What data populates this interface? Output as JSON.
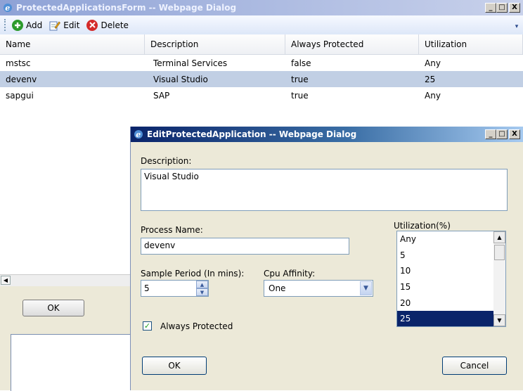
{
  "main_window": {
    "title": "ProtectedApplicationsForm -- Webpage Dialog",
    "caption_buttons": {
      "minimize": "_",
      "maximize": "□",
      "close": "X"
    },
    "toolbar": {
      "add_label": "Add",
      "edit_label": "Edit",
      "delete_label": "Delete",
      "icons": {
        "add": "add-icon",
        "edit": "edit-icon",
        "delete": "delete-icon"
      }
    },
    "grid": {
      "columns": [
        "Name",
        "Description",
        "Always Protected",
        "Utilization"
      ],
      "rows": [
        {
          "name": "mstsc",
          "description": "Terminal Services",
          "always_protected": "false",
          "utilization": "Any",
          "selected": false
        },
        {
          "name": "devenv",
          "description": "Visual Studio",
          "always_protected": "true",
          "utilization": "25",
          "selected": true
        },
        {
          "name": "sapgui",
          "description": "SAP",
          "always_protected": "true",
          "utilization": "Any",
          "selected": false
        }
      ]
    },
    "ok_label": "OK"
  },
  "edit_dialog": {
    "title": "EditProtectedApplication -- Webpage Dialog",
    "caption_buttons": {
      "minimize": "_",
      "maximize": "□",
      "close": "X"
    },
    "description_label": "Description:",
    "description_value": "Visual Studio",
    "process_name_label": "Process Name:",
    "process_name_value": "devenv",
    "sample_period_label": "Sample Period (In mins):",
    "sample_period_value": "5",
    "cpu_affinity_label": "Cpu Affinity:",
    "cpu_affinity_value": "One",
    "utilization_label": "Utilization(%)",
    "utilization_options": [
      "Any",
      "5",
      "10",
      "15",
      "20",
      "25"
    ],
    "utilization_selected": "25",
    "always_protected_label": "Always Protected",
    "always_protected_checked": true,
    "ok_label": "OK",
    "cancel_label": "Cancel"
  },
  "colors": {
    "selection": "#0a246a",
    "grid_selected_row": "#c1cfe4",
    "dialog_background": "#ece9d8"
  }
}
